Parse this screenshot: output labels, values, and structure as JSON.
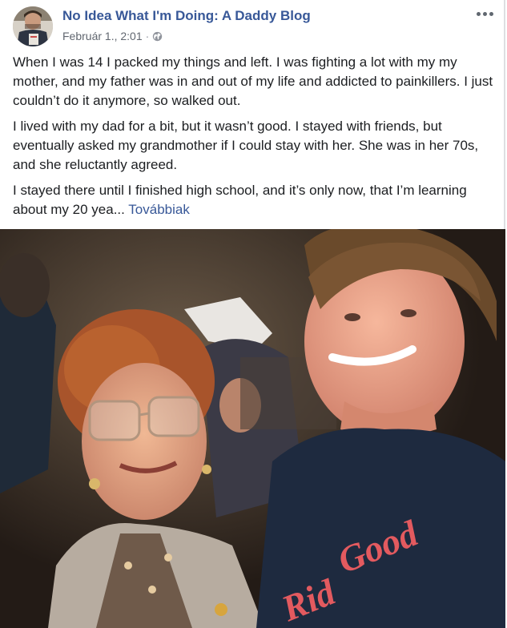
{
  "post": {
    "author": "No Idea What I'm Doing: A Daddy Blog",
    "date": "Február 1., 2:01",
    "separator": "·",
    "privacy_icon": "globe-icon",
    "more_icon": "more-options-icon",
    "paragraphs": [
      "When I was 14 I packed my things and left. I was fighting a lot with my my mother, and my father was in and out of my life and addicted to painkillers. I just couldn’t do it anymore, so walked out.",
      "I lived with my dad for a bit, but it wasn’t good. I stayed with friends, but eventually asked my grandmother if I could stay with her. She was in her 70s, and she reluctantly agreed."
    ],
    "last_paragraph": "I stayed there until I finished high school, and it’s only now, that I’m learning about my 20 yea...",
    "see_more": "Továbbiak",
    "photo_shirt_text_1": "Good",
    "photo_shirt_text_2": "Rid"
  },
  "colors": {
    "link": "#385898",
    "text": "#1c1e21",
    "meta": "#616770",
    "shirt": "#1e2a3f",
    "shirt_print": "#e35a5f"
  }
}
